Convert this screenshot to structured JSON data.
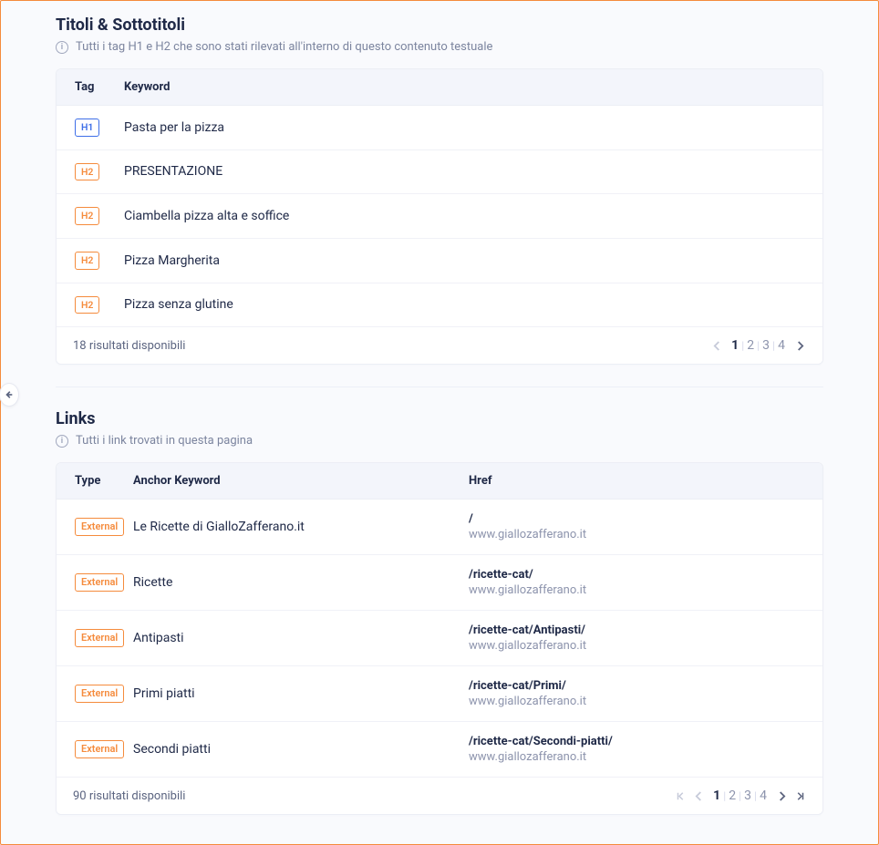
{
  "headings_section": {
    "title": "Titoli & Sottotitoli",
    "subtitle": "Tutti i tag H1 e H2 che sono stati rilevati all'interno di questo contenuto testuale",
    "columns": {
      "tag": "Tag",
      "keyword": "Keyword"
    },
    "rows": [
      {
        "tag": "H1",
        "keyword": "Pasta per la pizza"
      },
      {
        "tag": "H2",
        "keyword": "PRESENTAZIONE"
      },
      {
        "tag": "H2",
        "keyword": "Ciambella pizza alta e soffice"
      },
      {
        "tag": "H2",
        "keyword": "Pizza Margherita"
      },
      {
        "tag": "H2",
        "keyword": "Pizza senza glutine"
      }
    ],
    "footer_text": "18 risultati disponibili",
    "pages": [
      "1",
      "2",
      "3",
      "4"
    ],
    "current_page": "1"
  },
  "links_section": {
    "title": "Links",
    "subtitle": "Tutti i link trovati in questa pagina",
    "columns": {
      "type": "Type",
      "anchor": "Anchor Keyword",
      "href": "Href"
    },
    "type_label": "External",
    "rows": [
      {
        "anchor": "Le Ricette di GialloZafferano.it",
        "path": "/",
        "domain": "www.giallozafferano.it"
      },
      {
        "anchor": "Ricette",
        "path": "/ricette-cat/",
        "domain": "www.giallozafferano.it"
      },
      {
        "anchor": "Antipasti",
        "path": "/ricette-cat/Antipasti/",
        "domain": "www.giallozafferano.it"
      },
      {
        "anchor": "Primi piatti",
        "path": "/ricette-cat/Primi/",
        "domain": "www.giallozafferano.it"
      },
      {
        "anchor": "Secondi piatti",
        "path": "/ricette-cat/Secondi-piatti/",
        "domain": "www.giallozafferano.it"
      }
    ],
    "footer_text": "90 risultati disponibili",
    "pages": [
      "1",
      "2",
      "3",
      "4"
    ],
    "current_page": "1"
  }
}
